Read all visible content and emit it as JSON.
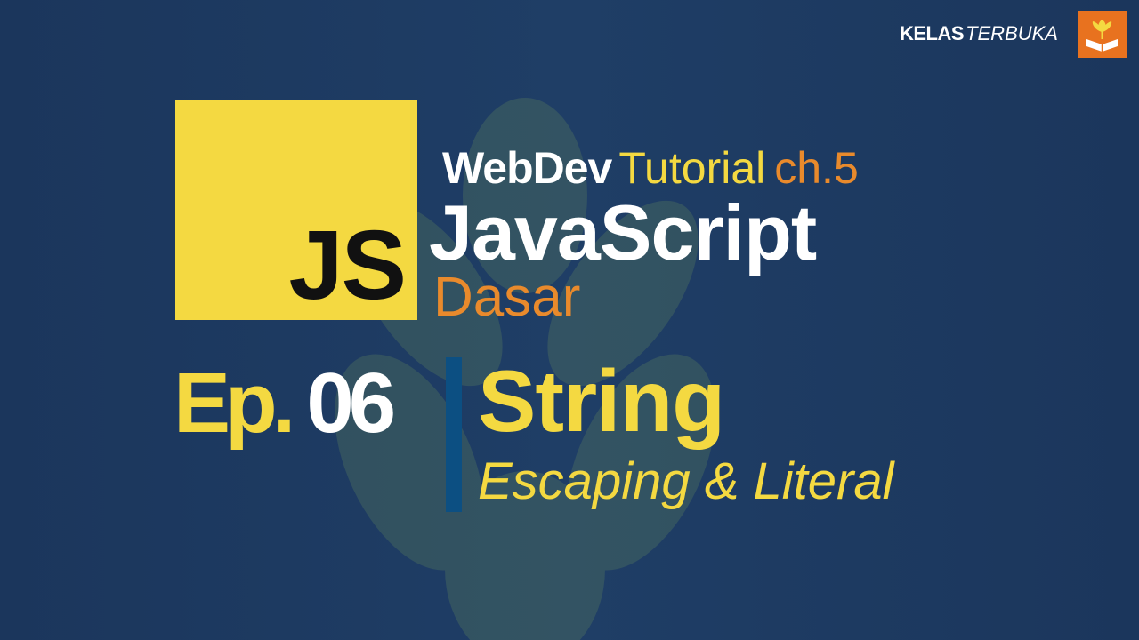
{
  "colors": {
    "background": "#1e3b63",
    "js_yellow": "#f4d941",
    "accent_orange": "#e98a2c",
    "text_white": "#ffffff",
    "divider_blue": "#0c4f82"
  },
  "logo": {
    "text": "JS"
  },
  "series": {
    "brand": "WebDev",
    "type": "Tutorial",
    "chapter": "ch.5"
  },
  "course": {
    "title": "JavaScript",
    "level": "Dasar"
  },
  "episode": {
    "label": "Ep.",
    "number": "06"
  },
  "topic": {
    "title": "String",
    "subtitle": "Escaping & Literal"
  },
  "brand": {
    "name_bold": "KELAS",
    "name_italic": "TERBUKA",
    "logo_icon": "book-sprout-icon"
  }
}
